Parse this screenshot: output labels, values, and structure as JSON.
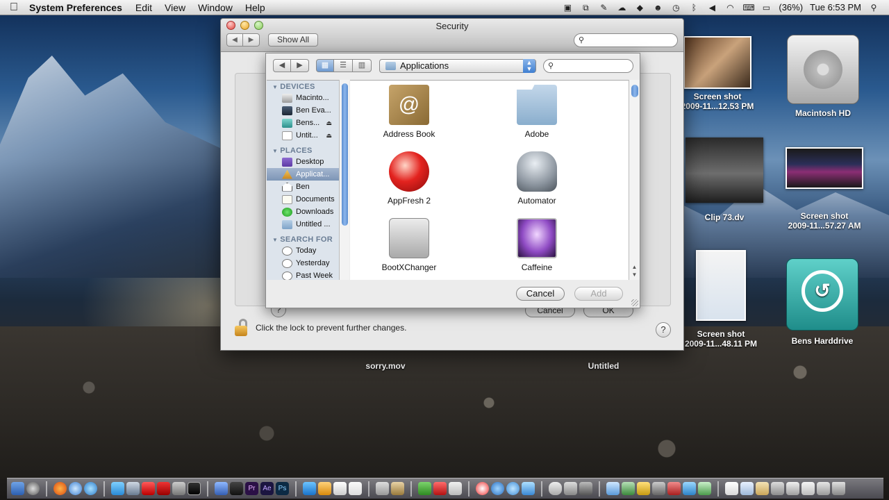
{
  "menubar": {
    "apple": "",
    "app_name": "System Preferences",
    "menus": [
      "Edit",
      "View",
      "Window",
      "Help"
    ],
    "battery": "(36%)",
    "clock": "Tue 6:53 PM"
  },
  "desktop_icons": [
    {
      "name": "desktop-icon-screenshot-1",
      "label1": "Screen shot",
      "label2": "2009-11...12.53 PM"
    },
    {
      "name": "desktop-icon-macintosh-hd",
      "label1": "Macintosh HD",
      "label2": ""
    },
    {
      "name": "desktop-icon-clip-73",
      "label1": "Clip 73.dv",
      "label2": ""
    },
    {
      "name": "desktop-icon-screenshot-2",
      "label1": "Screen shot",
      "label2": "2009-11...57.27 AM"
    },
    {
      "name": "desktop-icon-screenshot-3",
      "label1": "Screen shot",
      "label2": "2009-11...48.11 PM"
    },
    {
      "name": "desktop-icon-bens-harddrive",
      "label1": "Bens Harddrive",
      "label2": ""
    },
    {
      "name": "desktop-icon-sorry-mov",
      "label1": "sorry.mov",
      "label2": ""
    },
    {
      "name": "desktop-icon-untitled",
      "label1": "Untitled",
      "label2": ""
    }
  ],
  "security_window": {
    "title": "Security",
    "show_all": "Show All",
    "search_glyph": "⚲",
    "under_cancel": "Cancel",
    "under_ok": "OK",
    "lock_text": "Click the lock to prevent further changes.",
    "help": "?"
  },
  "sheet": {
    "location": "Applications",
    "search_glyph": "⚲",
    "sidebar": {
      "devices_header": "DEVICES",
      "devices": [
        "Macinto...",
        "Ben Eva...",
        "Bens...",
        "Untit..."
      ],
      "places_header": "PLACES",
      "places": [
        "Desktop",
        "Applicat...",
        "Ben",
        "Documents",
        "Downloads",
        "Untitled ..."
      ],
      "search_header": "SEARCH FOR",
      "searches": [
        "Today",
        "Yesterday",
        "Past Week"
      ]
    },
    "files": [
      "Address Book",
      "Adobe",
      "AppFresh 2",
      "Automator",
      "BootXChanger",
      "Caffeine"
    ],
    "cancel": "Cancel",
    "add": "Add"
  }
}
